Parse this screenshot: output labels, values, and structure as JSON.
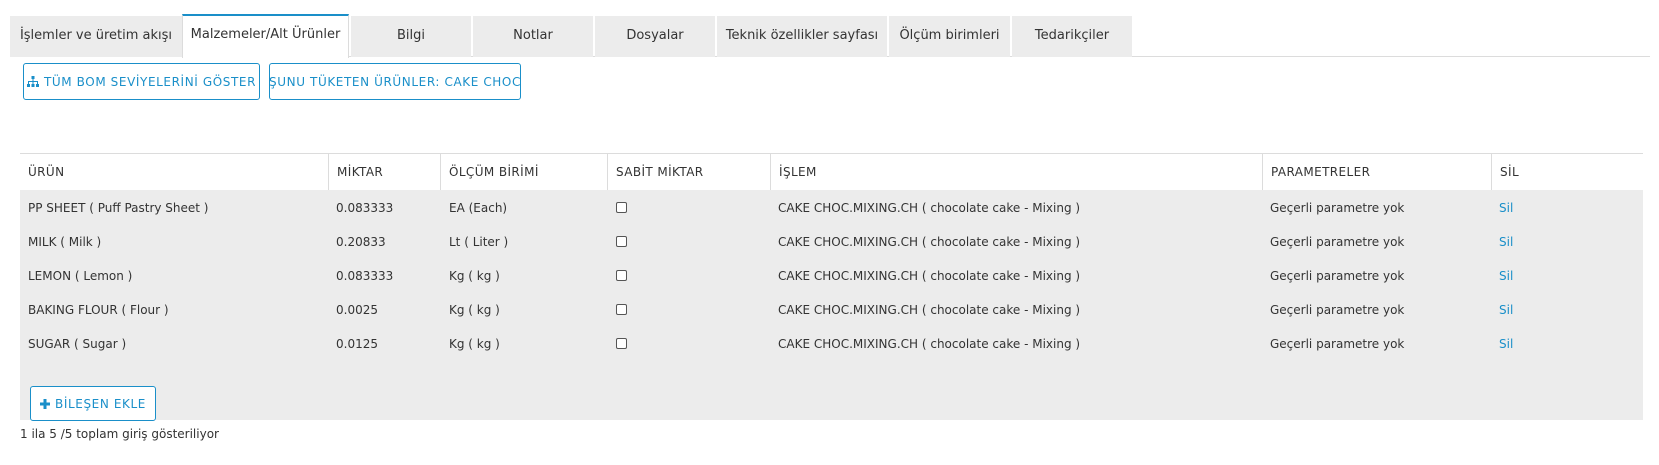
{
  "tabs": [
    {
      "label": "İşlemler ve üretim akışı",
      "active": false
    },
    {
      "label": "Malzemeler/Alt Ürünler",
      "active": true
    },
    {
      "label": "Bilgi",
      "active": false
    },
    {
      "label": "Notlar",
      "active": false
    },
    {
      "label": "Dosyalar",
      "active": false
    },
    {
      "label": "Teknik özellikler sayfası",
      "active": false
    },
    {
      "label": "Ölçüm birimleri",
      "active": false
    },
    {
      "label": "Tedarikçiler",
      "active": false
    }
  ],
  "actions": {
    "show_bom_levels": "TÜM BOM SEVİYELERİNİ GÖSTER",
    "consuming_products": "ŞUNU TÜKETEN ÜRÜNLER: CAKE CHOC",
    "add_component": "BİLEŞEN EKLE"
  },
  "table": {
    "columns": [
      "ÜRÜN",
      "MİKTAR",
      "ÖLÇÜM BİRİMİ",
      "SABİT MİKTAR",
      "İŞLEM",
      "PARAMETRELER",
      "SİL"
    ],
    "rows": [
      {
        "product": "PP SHEET ( Puff Pastry Sheet )",
        "quantity": "0.083333",
        "unit": "EA (Each)",
        "fixed": false,
        "operation": "CAKE CHOC.MIXING.CH ( chocolate cake - Mixing )",
        "params": "Geçerli parametre yok",
        "delete": "Sil"
      },
      {
        "product": "MILK ( Milk )",
        "quantity": "0.20833",
        "unit": "Lt ( Liter )",
        "fixed": false,
        "operation": "CAKE CHOC.MIXING.CH ( chocolate cake - Mixing )",
        "params": "Geçerli parametre yok",
        "delete": "Sil"
      },
      {
        "product": "LEMON ( Lemon )",
        "quantity": "0.083333",
        "unit": "Kg ( kg )",
        "fixed": false,
        "operation": "CAKE CHOC.MIXING.CH ( chocolate cake - Mixing )",
        "params": "Geçerli parametre yok",
        "delete": "Sil"
      },
      {
        "product": "BAKING FLOUR ( Flour )",
        "quantity": "0.0025",
        "unit": "Kg ( kg )",
        "fixed": false,
        "operation": "CAKE CHOC.MIXING.CH ( chocolate cake - Mixing )",
        "params": "Geçerli parametre yok",
        "delete": "Sil"
      },
      {
        "product": "SUGAR ( Sugar )",
        "quantity": "0.0125",
        "unit": "Kg ( kg )",
        "fixed": false,
        "operation": "CAKE CHOC.MIXING.CH ( chocolate cake - Mixing )",
        "params": "Geçerli parametre yok",
        "delete": "Sil"
      }
    ]
  },
  "footer": {
    "entries_text": "1 ila 5 /5 toplam giriş gösteriliyor"
  },
  "icons": {
    "hierarchy": "sitemap-icon",
    "add": "plus-icon"
  },
  "colors": {
    "accent": "#1a8fc9",
    "row_bg": "#ececec",
    "tab_bg": "#ececec"
  }
}
